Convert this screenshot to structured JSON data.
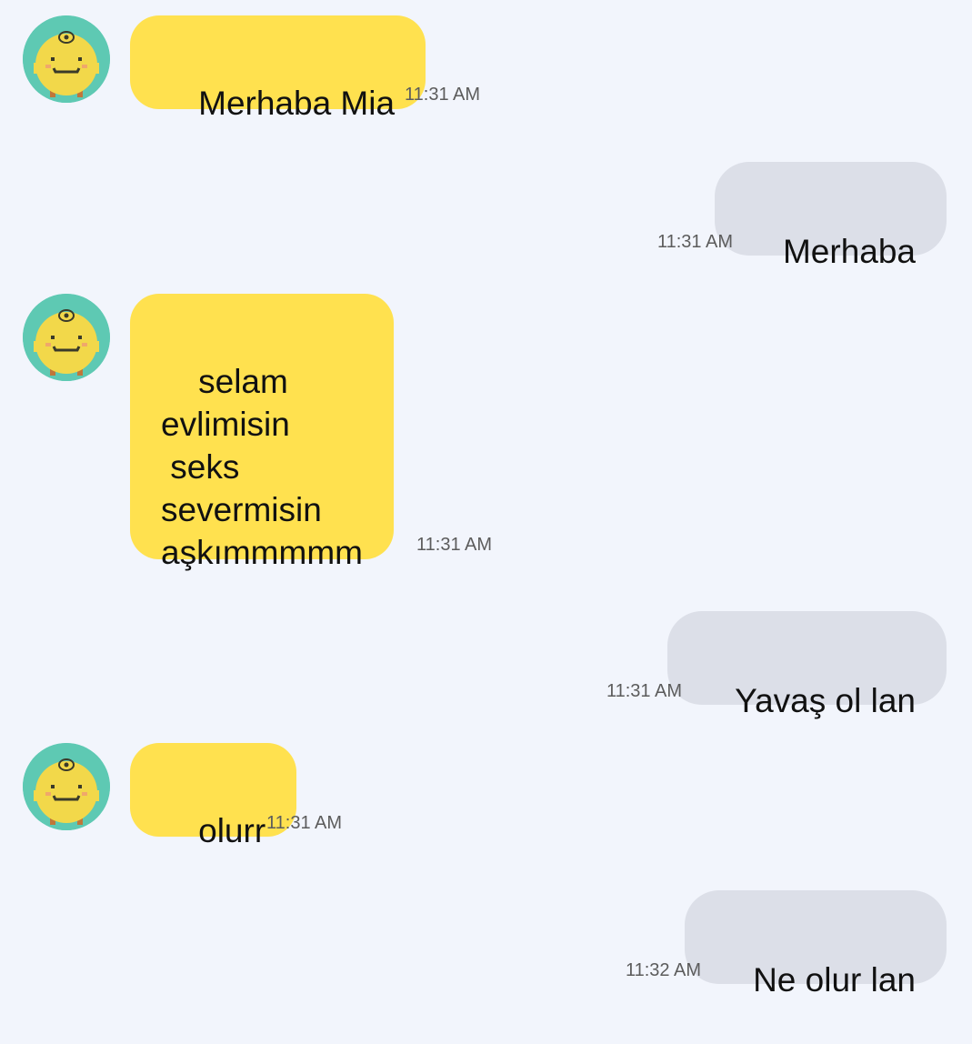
{
  "messages": [
    {
      "direction": "incoming",
      "text": "Merhaba Mia",
      "time": "11:31 AM",
      "avatar_icon": "yellow-smiley-avatar-icon"
    },
    {
      "direction": "outgoing",
      "text": "Merhaba",
      "time": "11:31 AM"
    },
    {
      "direction": "incoming",
      "text": "selam\nevlimisin\n seks\nsevermisin\naşkımmmmm",
      "time": "11:31 AM",
      "avatar_icon": "yellow-smiley-avatar-icon"
    },
    {
      "direction": "outgoing",
      "text": "Yavaş ol lan",
      "time": "11:31 AM"
    },
    {
      "direction": "incoming",
      "text": "olurr",
      "time": "11:31 AM",
      "avatar_icon": "yellow-smiley-avatar-icon"
    },
    {
      "direction": "outgoing",
      "text": "Ne olur lan",
      "time": "11:32 AM"
    }
  ],
  "colors": {
    "background": "#f2f5fc",
    "incoming_bubble": "#ffe14f",
    "outgoing_bubble": "#dcdfe8",
    "avatar_ring": "#5ec9b3",
    "timestamp_text": "#5c5c5c"
  }
}
